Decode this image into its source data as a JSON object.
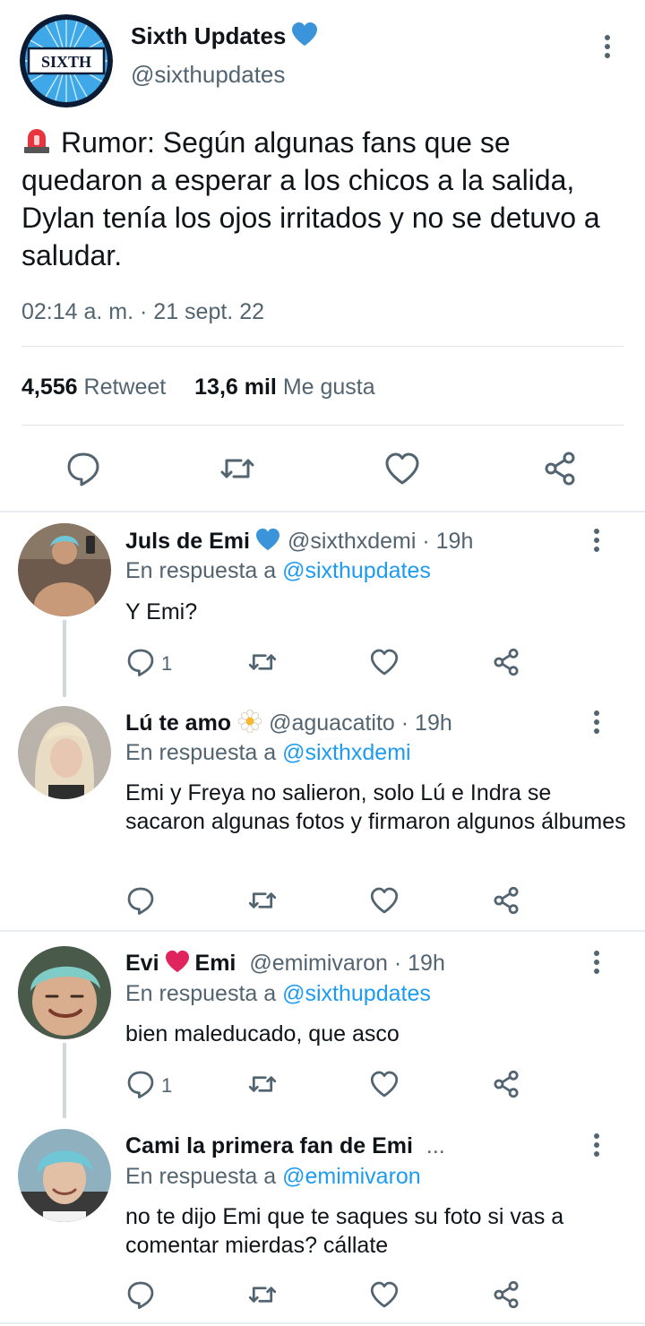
{
  "main_tweet": {
    "author_name": "Sixth Updates",
    "handle": "@sixthupdates",
    "avatar_text": "SIXTH",
    "text": "Rumor: Según algunas fans que se quedaron a esperar a los chicos a la salida, Dylan tenía los ojos irritados y no se detuvo a saludar.",
    "timestamp": "02:14 a. m. · 21 sept. 22",
    "retweets": "4,556",
    "retweets_label": "Retweet",
    "likes": "13,6 mil",
    "likes_label": "Me gusta"
  },
  "replies": [
    {
      "name": "Juls de Emi",
      "handle": "@sixthxdemi · 19h",
      "reply_prefix": "En respuesta a",
      "reply_to": "@sixthupdates",
      "text": "Y Emi?",
      "reply_count": "1"
    },
    {
      "name": "Lú te amo",
      "handle": "@aguacatito · 19h",
      "reply_prefix": "En respuesta a",
      "reply_to": "@sixthxdemi",
      "text": "Emi y Freya no salieron, solo Lú e Indra se sacaron algunas fotos y firmaron algunos álbumes",
      "reply_count": ""
    },
    {
      "name_part1": "Evi",
      "name_part2": "Emi",
      "handle": "@emimivaron · 19h",
      "reply_prefix": "En respuesta a",
      "reply_to": "@sixthupdates",
      "text": "bien maleducado, que asco",
      "reply_count": "1"
    },
    {
      "name": "Cami la primera fan de Emi",
      "truncation": "...",
      "reply_prefix": "En respuesta a",
      "reply_to": "@emimivaron",
      "text": "no te dijo Emi que te saques su foto si vas a comentar mierdas? cállate",
      "reply_count": ""
    }
  ],
  "colors": {
    "accent": "#1d9bf0",
    "secondary_text": "#536471",
    "primary_text": "#0f1419",
    "heart_emoji": "#e0245e"
  },
  "icons": [
    "verified-icon",
    "siren-icon",
    "reply-icon",
    "retweet-icon",
    "like-icon",
    "share-icon",
    "more-icon",
    "daisy-icon",
    "heart-emoji-icon"
  ]
}
